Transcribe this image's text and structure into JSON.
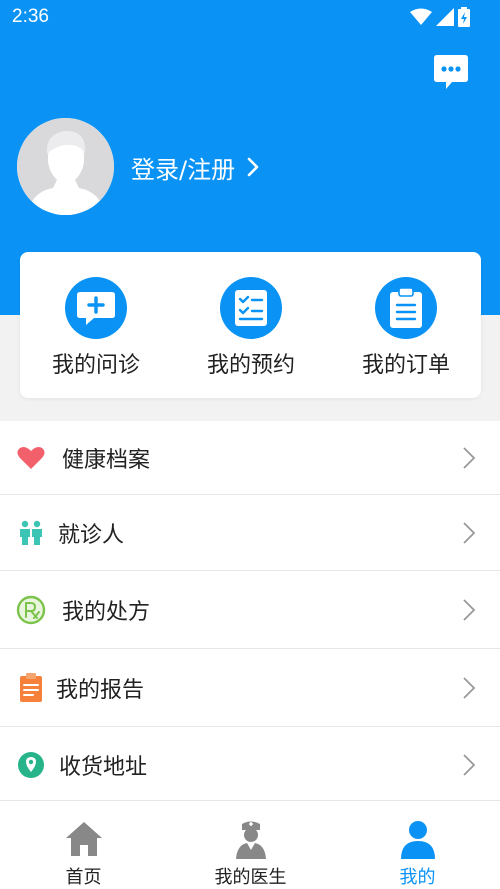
{
  "status_bar": {
    "time": "2:36"
  },
  "header": {
    "login_label": "登录/注册"
  },
  "quick_actions": [
    {
      "label": "我的问诊",
      "icon": "consult-chat-icon"
    },
    {
      "label": "我的预约",
      "icon": "checklist-icon"
    },
    {
      "label": "我的订单",
      "icon": "clipboard-icon"
    }
  ],
  "menu": [
    {
      "label": "健康档案",
      "icon": "heart-icon"
    },
    {
      "label": "就诊人",
      "icon": "people-icon"
    },
    {
      "label": "我的处方",
      "icon": "prescription-icon"
    },
    {
      "label": "我的报告",
      "icon": "report-icon"
    },
    {
      "label": "收货地址",
      "icon": "location-pin-icon"
    }
  ],
  "tabbar": [
    {
      "label": "首页",
      "icon": "home-icon"
    },
    {
      "label": "我的医生",
      "icon": "doctor-icon"
    },
    {
      "label": "我的",
      "icon": "person-icon",
      "active": true
    }
  ],
  "colors": {
    "primary": "#0a93f5",
    "heart": "#f2606b",
    "people": "#3cc4b4",
    "prescription": "#7bc34a",
    "report": "#f5813a",
    "location": "#27b48a"
  }
}
